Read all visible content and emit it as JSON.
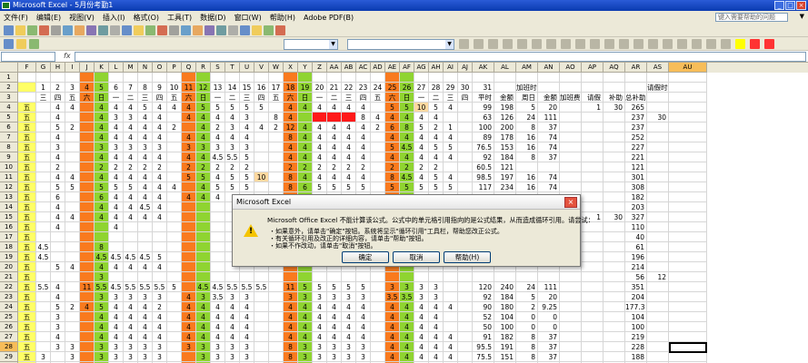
{
  "window": {
    "title": "Microsoft Excel - 5月份考勤1"
  },
  "menu": [
    "文件(F)",
    "编辑(E)",
    "视图(V)",
    "插入(I)",
    "格式(O)",
    "工具(T)",
    "数据(D)",
    "窗口(W)",
    "帮助(H)",
    "Adobe PDF(B)"
  ],
  "help_placeholder": "键入需要帮助的问题",
  "formula_bar": {
    "name_box": "",
    "fx": "fx",
    "content": ""
  },
  "columns": [
    "F",
    "G",
    "H",
    "I",
    "J",
    "K",
    "L",
    "M",
    "N",
    "O",
    "P",
    "Q",
    "R",
    "S",
    "T",
    "U",
    "V",
    "W",
    "X",
    "Y",
    "Z",
    "AA",
    "AB",
    "AC",
    "AD",
    "AE",
    "AF",
    "AG",
    "AH",
    "AI",
    "AJ",
    "AK",
    "AL",
    "AM",
    "AN",
    "AO",
    "AP",
    "AQ",
    "AR",
    "AS",
    "AU"
  ],
  "rows": [
    {
      "n": "1",
      "cells": {}
    },
    {
      "n": "2",
      "cells": {
        "G": "1",
        "H": "2",
        "I": "3",
        "J": "4",
        "K": "5",
        "L": "6",
        "M": "7",
        "N": "8",
        "O": "9",
        "P": "10",
        "Q": "11",
        "R": "12",
        "S": "13",
        "T": "14",
        "U": "15",
        "V": "16",
        "W": "17",
        "X": "18",
        "Y": "19",
        "Z": "20",
        "AA": "21",
        "AB": "22",
        "AC": "23",
        "AD": "24",
        "AE": "25",
        "AF": "26",
        "AG": "27",
        "AH": "28",
        "AI": "29",
        "AJ": "30",
        "AK": "31",
        "AM": "加班时数",
        "AS": "请假时数"
      }
    },
    {
      "n": "3",
      "cells": {
        "G": "三",
        "H": "四",
        "I": "五",
        "J": "六",
        "K": "日",
        "L": "一",
        "M": "二",
        "N": "三",
        "O": "四",
        "P": "五",
        "Q": "六",
        "R": "日",
        "S": "一",
        "T": "二",
        "U": "三",
        "V": "四",
        "W": "五",
        "X": "六",
        "Y": "日",
        "Z": "一",
        "AA": "二",
        "AB": "三",
        "AC": "四",
        "AD": "五",
        "AE": "六",
        "AF": "日",
        "AG": "一",
        "AH": "二",
        "AI": "三",
        "AJ": "四",
        "AK": "平时",
        "AL": "金额",
        "AM": "周日",
        "AN": "金额",
        "AO": "加班费",
        "AP": "请假",
        "AQ": "补助",
        "AR": "总补助"
      }
    },
    {
      "n": "4",
      "cells": {
        "F": "五",
        "H": "4",
        "I": "4",
        "K": "4",
        "L": "4",
        "M": "4",
        "N": "5",
        "O": "4",
        "P": "4",
        "Q": "4",
        "R": "5",
        "S": "5",
        "T": "5",
        "U": "5",
        "V": "5",
        "X": "4",
        "Y": "4",
        "Z": "4",
        "AA": "4",
        "AB": "4",
        "AC": "4",
        "AE": "5",
        "AF": "5",
        "AG": "10",
        "AH": "5",
        "AI": "4",
        "AK": "99",
        "AL": "198",
        "AM": "5",
        "AN": "20",
        "AP": "1",
        "AQ": "30",
        "AR": "265"
      }
    },
    {
      "n": "5",
      "cells": {
        "F": "五",
        "H": "4",
        "K": "4",
        "L": "3",
        "M": "3",
        "N": "4",
        "O": "4",
        "Q": "4",
        "R": "4",
        "S": "4",
        "T": "4",
        "U": "3",
        "W": "8",
        "X": "4",
        "AC": "8",
        "AD": "4",
        "AE": "4",
        "AF": "4",
        "AG": "4",
        "AH": "4",
        "AK": "63",
        "AL": "126",
        "AM": "24",
        "AN": "111",
        "AR": "237",
        "AS": "30"
      }
    },
    {
      "n": "6",
      "cells": {
        "F": "五",
        "H": "5",
        "I": "2",
        "K": "4",
        "L": "4",
        "M": "4",
        "N": "4",
        "O": "4",
        "P": "2",
        "R": "4",
        "S": "2",
        "T": "3",
        "U": "4",
        "V": "4",
        "W": "2",
        "X": "12",
        "Y": "4",
        "Z": "4",
        "AA": "4",
        "AB": "4",
        "AC": "4",
        "AD": "2",
        "AE": "6",
        "AF": "8",
        "AG": "5",
        "AH": "2",
        "AI": "1",
        "AK": "100",
        "AL": "200",
        "AM": "8",
        "AN": "37",
        "AR": "237"
      }
    },
    {
      "n": "7",
      "cells": {
        "F": "五",
        "H": "4",
        "K": "4",
        "L": "4",
        "M": "4",
        "N": "4",
        "O": "4",
        "Q": "4",
        "R": "4",
        "S": "4",
        "T": "4",
        "U": "4",
        "X": "8",
        "Y": "4",
        "Z": "4",
        "AA": "4",
        "AB": "4",
        "AC": "4",
        "AE": "4",
        "AF": "4",
        "AG": "4",
        "AH": "4",
        "AI": "4",
        "AK": "89",
        "AL": "178",
        "AM": "16",
        "AN": "74",
        "AR": "252"
      }
    },
    {
      "n": "8",
      "cells": {
        "F": "五",
        "H": "3",
        "K": "3",
        "L": "3",
        "M": "3",
        "N": "3",
        "O": "3",
        "Q": "3",
        "R": "3",
        "S": "3",
        "T": "3",
        "U": "3",
        "X": "4",
        "Y": "4",
        "Z": "4",
        "AA": "4",
        "AB": "4",
        "AC": "4",
        "AE": "5",
        "AF": "4.5",
        "AG": "4",
        "AH": "5",
        "AI": "5",
        "AK": "76.5",
        "AL": "153",
        "AM": "16",
        "AN": "74",
        "AR": "227"
      }
    },
    {
      "n": "9",
      "cells": {
        "F": "五",
        "H": "4",
        "K": "4",
        "L": "4",
        "M": "4",
        "N": "4",
        "O": "4",
        "Q": "4",
        "R": "4",
        "S": "4.5",
        "T": "5.5",
        "U": "5",
        "X": "4",
        "Y": "4",
        "Z": "4",
        "AA": "4",
        "AB": "4",
        "AC": "4",
        "AE": "4",
        "AF": "4",
        "AG": "4",
        "AH": "4",
        "AI": "4",
        "AK": "92",
        "AL": "184",
        "AM": "8",
        "AN": "37",
        "AR": "221"
      }
    },
    {
      "n": "10",
      "cells": {
        "F": "五",
        "H": "2",
        "K": "2",
        "L": "2",
        "M": "2",
        "N": "2",
        "O": "2",
        "Q": "2",
        "R": "2",
        "S": "2",
        "T": "2",
        "U": "2",
        "X": "2",
        "Y": "2",
        "Z": "2",
        "AA": "2",
        "AB": "2",
        "AC": "2",
        "AE": "2",
        "AF": "2",
        "AG": "2",
        "AH": "2",
        "AK": "60.5",
        "AL": "121",
        "AR": "121"
      }
    },
    {
      "n": "11",
      "cells": {
        "F": "五",
        "H": "4",
        "I": "4",
        "K": "4",
        "L": "4",
        "M": "4",
        "N": "4",
        "O": "4",
        "Q": "5",
        "R": "5",
        "S": "4",
        "T": "5",
        "U": "5",
        "V": "10",
        "X": "8",
        "Y": "4",
        "Z": "4",
        "AA": "4",
        "AB": "4",
        "AC": "4",
        "AE": "8",
        "AF": "4.5",
        "AG": "4",
        "AH": "5",
        "AI": "4",
        "AK": "98.5",
        "AL": "197",
        "AM": "16",
        "AN": "74",
        "AR": "301"
      }
    },
    {
      "n": "12",
      "cells": {
        "F": "五",
        "H": "5",
        "I": "5",
        "K": "5",
        "L": "5",
        "M": "5",
        "N": "4",
        "O": "4",
        "P": "4",
        "R": "4",
        "S": "5",
        "T": "5",
        "U": "5",
        "X": "8",
        "Y": "6",
        "Z": "5",
        "AA": "5",
        "AB": "5",
        "AC": "5",
        "AE": "5",
        "AF": "5",
        "AG": "5",
        "AH": "5",
        "AI": "5",
        "AK": "117",
        "AL": "234",
        "AM": "16",
        "AN": "74",
        "AR": "308"
      }
    },
    {
      "n": "13",
      "cells": {
        "F": "五",
        "H": "6",
        "K": "6",
        "L": "4",
        "M": "4",
        "N": "4",
        "O": "4",
        "Q": "4",
        "R": "4",
        "S": "4",
        "AK": "74.5",
        "AL": "149",
        "AM": "8",
        "AN": "37",
        "AR": "182"
      }
    },
    {
      "n": "14",
      "cells": {
        "F": "五",
        "H": "4",
        "K": "4",
        "L": "4",
        "M": "4",
        "N": "4.5",
        "O": "4",
        "AR": "203"
      }
    },
    {
      "n": "15",
      "cells": {
        "F": "五",
        "H": "4",
        "I": "4",
        "K": "4",
        "L": "4",
        "M": "4",
        "N": "4",
        "O": "4",
        "AP": "1",
        "AQ": "30",
        "AR": "327"
      }
    },
    {
      "n": "16",
      "cells": {
        "F": "五",
        "H": "4",
        "L": "4",
        "AR": "110"
      }
    },
    {
      "n": "17",
      "cells": {
        "F": "五",
        "AR": "40"
      }
    },
    {
      "n": "18",
      "cells": {
        "F": "五",
        "G": "4.5",
        "K": "8",
        "AR": "61"
      }
    },
    {
      "n": "19",
      "cells": {
        "F": "五",
        "G": "4.5",
        "K": "4.5",
        "L": "4.5",
        "M": "4.5",
        "N": "4.5",
        "O": "5",
        "AR": "196"
      }
    },
    {
      "n": "20",
      "cells": {
        "F": "五",
        "H": "5",
        "I": "4",
        "K": "4",
        "L": "4",
        "M": "4",
        "N": "4",
        "O": "4",
        "AR": "214"
      }
    },
    {
      "n": "21",
      "cells": {
        "F": "五",
        "K": "3",
        "AR": "56",
        "AS": "12"
      }
    },
    {
      "n": "22",
      "cells": {
        "F": "五",
        "G": "5.5",
        "H": "4",
        "J": "11",
        "K": "5.5",
        "L": "4.5",
        "M": "5.5",
        "N": "5.5",
        "O": "5.5",
        "P": "5",
        "R": "4.5",
        "S": "4.5",
        "T": "5.5",
        "U": "5.5",
        "V": "5.5",
        "X": "11",
        "Y": "5",
        "Z": "5",
        "AA": "5",
        "AB": "5",
        "AC": "5",
        "AE": "3",
        "AF": "3",
        "AG": "3",
        "AH": "3",
        "AK": "120",
        "AL": "240",
        "AM": "24",
        "AN": "111",
        "AR": "351"
      }
    },
    {
      "n": "23",
      "cells": {
        "F": "五",
        "H": "4",
        "K": "3",
        "L": "3",
        "M": "3",
        "N": "3",
        "O": "3",
        "Q": "4",
        "R": "3",
        "S": "3.5",
        "T": "3",
        "U": "3",
        "X": "3",
        "Y": "3",
        "Z": "3",
        "AA": "3",
        "AB": "3",
        "AC": "3",
        "AE": "3.5",
        "AF": "3.5",
        "AG": "3",
        "AH": "3",
        "AK": "92",
        "AL": "184",
        "AM": "5",
        "AN": "20",
        "AR": "204"
      }
    },
    {
      "n": "24",
      "cells": {
        "F": "五",
        "H": "5",
        "I": "2",
        "J": "4",
        "K": "5",
        "L": "4",
        "M": "4",
        "N": "4",
        "O": "2",
        "Q": "4",
        "R": "4",
        "S": "4",
        "T": "4",
        "U": "4",
        "X": "4",
        "Y": "4",
        "Z": "4",
        "AA": "4",
        "AB": "4",
        "AC": "4",
        "AE": "4",
        "AF": "4",
        "AG": "4",
        "AH": "4",
        "AI": "4",
        "AK": "90",
        "AL": "180",
        "AM": "2",
        "AN": "9.25",
        "AR": "177.3"
      }
    },
    {
      "n": "25",
      "cells": {
        "F": "五",
        "H": "3",
        "K": "4",
        "L": "4",
        "M": "4",
        "N": "4",
        "O": "4",
        "Q": "4",
        "R": "4",
        "S": "4",
        "T": "4",
        "U": "4",
        "X": "4",
        "Y": "4",
        "Z": "4",
        "AA": "4",
        "AB": "4",
        "AC": "4",
        "AE": "4",
        "AF": "4",
        "AG": "4",
        "AH": "4",
        "AK": "52",
        "AL": "104",
        "AM": "0",
        "AN": "0",
        "AR": "104"
      }
    },
    {
      "n": "26",
      "cells": {
        "F": "五",
        "H": "3",
        "K": "4",
        "L": "4",
        "M": "4",
        "N": "4",
        "O": "4",
        "Q": "4",
        "R": "4",
        "S": "4",
        "T": "4",
        "U": "4",
        "X": "4",
        "Y": "4",
        "Z": "4",
        "AA": "4",
        "AB": "4",
        "AC": "4",
        "AE": "4",
        "AF": "4",
        "AG": "4",
        "AH": "4",
        "AK": "50",
        "AL": "100",
        "AM": "0",
        "AN": "0",
        "AR": "100"
      }
    },
    {
      "n": "27",
      "cells": {
        "F": "五",
        "H": "4",
        "K": "4",
        "L": "4",
        "M": "4",
        "N": "4",
        "O": "4",
        "Q": "4",
        "R": "4",
        "S": "4",
        "T": "4",
        "U": "4",
        "X": "4",
        "Y": "4",
        "Z": "4",
        "AA": "4",
        "AB": "4",
        "AC": "4",
        "AE": "4",
        "AF": "4",
        "AG": "4",
        "AH": "4",
        "AI": "4",
        "AK": "91",
        "AL": "182",
        "AM": "8",
        "AN": "37",
        "AR": "219"
      }
    },
    {
      "n": "28",
      "cells": {
        "F": "五",
        "H": "3",
        "I": "3",
        "K": "3",
        "L": "3",
        "M": "3",
        "N": "3",
        "O": "3",
        "Q": "3",
        "R": "3",
        "S": "3",
        "T": "3",
        "U": "3",
        "X": "8",
        "Y": "3",
        "Z": "3",
        "AA": "3",
        "AB": "3",
        "AC": "3",
        "AE": "4",
        "AF": "4",
        "AG": "4",
        "AH": "4",
        "AI": "4",
        "AK": "95.5",
        "AL": "191",
        "AM": "8",
        "AN": "37",
        "AR": "228"
      }
    },
    {
      "n": "29",
      "cells": {
        "F": "五",
        "G": "3",
        "I": "3",
        "K": "3",
        "L": "3",
        "M": "3",
        "N": "3",
        "O": "3",
        "R": "3",
        "S": "3",
        "T": "3",
        "U": "3",
        "X": "8",
        "Y": "3",
        "Z": "3",
        "AA": "3",
        "AB": "3",
        "AC": "3",
        "AE": "4",
        "AF": "4",
        "AG": "4",
        "AH": "4",
        "AI": "4",
        "AK": "75.5",
        "AL": "151",
        "AM": "8",
        "AN": "37",
        "AR": "188"
      }
    },
    {
      "n": "30",
      "cells": {
        "F": "五",
        "H": "4",
        "K": "4",
        "L": "4",
        "M": "4",
        "N": "4",
        "O": "4",
        "Q": "4",
        "R": "4",
        "S": "4",
        "T": "4",
        "U": "4",
        "X": "4",
        "Y": "4",
        "Z": "4",
        "AA": "4",
        "AB": "4",
        "AC": "4",
        "AE": "4",
        "AF": "4",
        "AG": "4",
        "AH": "4",
        "AK": "87.5",
        "AL": "175",
        "AM": "4",
        "AN": "18.5",
        "AR": "194"
      }
    }
  ],
  "dialog": {
    "title": "Microsoft Excel",
    "message": "Microsoft Office Excel 不能计算该公式。公式中的单元格引用指向的是公式结果，从而造成循环引用。请尝试：",
    "bullets": [
      "・如果意外，请单击\"确定\"按钮。系统将显示\"循环引用\"工具栏，帮助您改正公式。",
      "・有关循环引用及改正的详细内容，请单击\"帮助\"按钮。",
      "・如果不作改动，请单击\"取消\"按钮。"
    ],
    "ok": "确定",
    "cancel": "取消",
    "help": "帮助(H)",
    "close": "×"
  },
  "colors": {
    "green": "#8fd431",
    "orange": "#f97a1e",
    "red": "#ff1a1a",
    "yellow": "#ffff66",
    "header_sel": "#f7bd59"
  }
}
